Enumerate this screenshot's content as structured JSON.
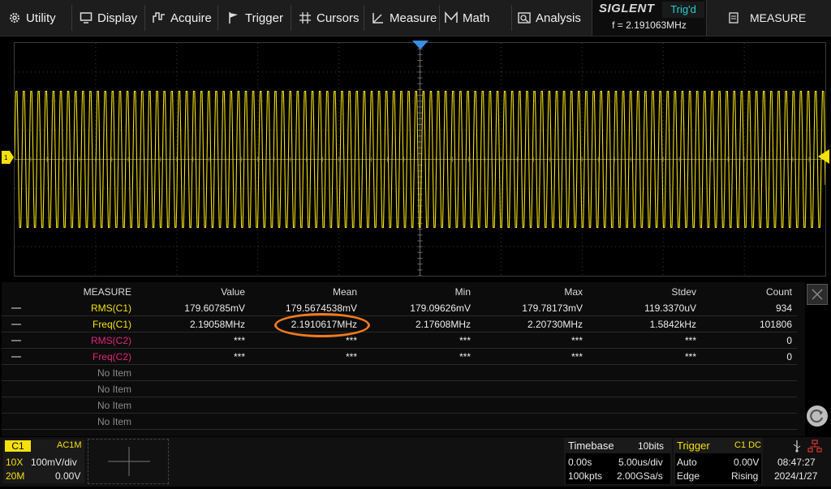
{
  "menu": {
    "utility": "Utility",
    "display": "Display",
    "acquire": "Acquire",
    "trigger": "Trigger",
    "cursors": "Cursors",
    "measure": "Measure",
    "math": "Math",
    "analysis": "Analysis"
  },
  "brand": {
    "logo": "SIGLENT",
    "trig_status": "Trig'd",
    "frequency": "f = 2.191063MHz"
  },
  "side_tab": {
    "label": "MEASURE"
  },
  "measure_table": {
    "headers": [
      "MEASURE",
      "Value",
      "Mean",
      "Min",
      "Max",
      "Stdev",
      "Count"
    ],
    "rows": [
      {
        "name": "RMS(C1)",
        "value": "179.60785mV",
        "mean": "179.5674538mV",
        "min": "179.09626mV",
        "max": "179.78173mV",
        "stdev": "119.3370uV",
        "count": "934"
      },
      {
        "name": "Freq(C1)",
        "value": "2.19058MHz",
        "mean": "2.1910617MHz",
        "min": "2.17608MHz",
        "max": "2.20730MHz",
        "stdev": "1.5842kHz",
        "count": "101806"
      },
      {
        "name": "RMS(C2)",
        "value": "***",
        "mean": "***",
        "min": "***",
        "max": "***",
        "stdev": "***",
        "count": "0"
      },
      {
        "name": "Freq(C2)",
        "value": "***",
        "mean": "***",
        "min": "***",
        "max": "***",
        "stdev": "***",
        "count": "0"
      },
      {
        "name": "No Item"
      },
      {
        "name": "No Item"
      },
      {
        "name": "No Item"
      },
      {
        "name": "No Item"
      }
    ]
  },
  "channel": {
    "tag": "C1",
    "coupling": "AC1M",
    "probe": "10X",
    "scale": "100mV/div",
    "bw": "20M",
    "offset": "0.00V"
  },
  "timebase": {
    "label": "Timebase",
    "bits": "10bits",
    "delay": "0.00s",
    "scale": "5.00us/div",
    "points": "100kpts",
    "rate": "2.00GSa/s"
  },
  "trigger": {
    "label": "Trigger",
    "source": "C1 DC",
    "mode": "Auto",
    "level": "0.00V",
    "type": "Edge",
    "slope": "Rising"
  },
  "system": {
    "time": "08:47:27",
    "date": "2024/1/27"
  },
  "colors": {
    "ch1": "#f5e10b",
    "ch2": "#e0267a",
    "trig": "#22d3d3",
    "accent": "#f07a1e",
    "trigger_marker": "#3a8ee6"
  }
}
